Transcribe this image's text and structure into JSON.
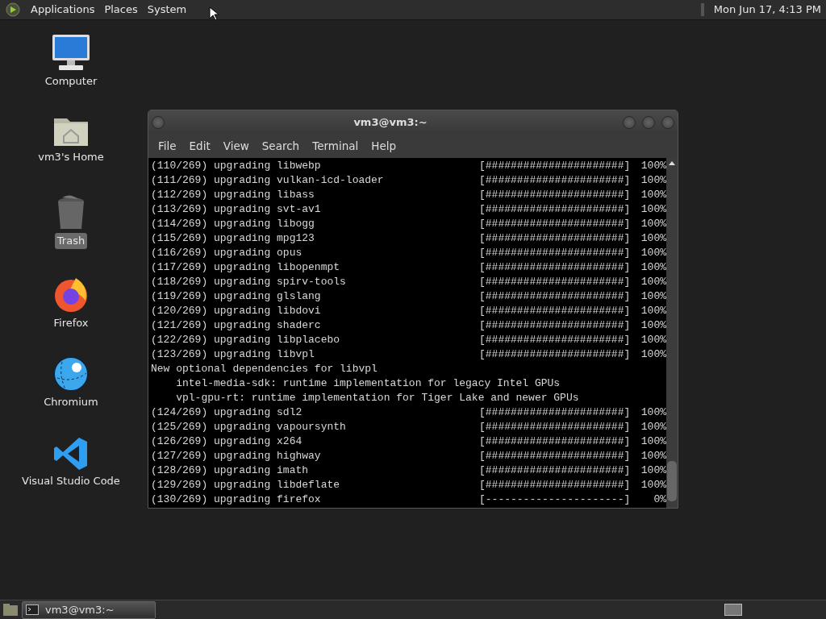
{
  "top_panel": {
    "menus": [
      "Applications",
      "Places",
      "System"
    ],
    "clock": "Mon Jun 17, 4:13 PM"
  },
  "desktop_icons": [
    {
      "kind": "computer",
      "label": "Computer",
      "selected": false
    },
    {
      "kind": "home",
      "label": "vm3's Home",
      "selected": false
    },
    {
      "kind": "trash",
      "label": "Trash",
      "selected": true
    },
    {
      "kind": "firefox",
      "label": "Firefox",
      "selected": false
    },
    {
      "kind": "chromium",
      "label": "Chromium",
      "selected": false
    },
    {
      "kind": "vscode",
      "label": "Visual Studio Code",
      "selected": false
    }
  ],
  "terminal": {
    "title": "vm3@vm3:~",
    "menus": [
      "File",
      "Edit",
      "View",
      "Search",
      "Terminal",
      "Help"
    ],
    "lines": [
      {
        "kind": "progress",
        "label": "(110/269) upgrading libwebp",
        "bar": "[######################]",
        "percent": "100%"
      },
      {
        "kind": "progress",
        "label": "(111/269) upgrading vulkan-icd-loader",
        "bar": "[######################]",
        "percent": "100%"
      },
      {
        "kind": "progress",
        "label": "(112/269) upgrading libass",
        "bar": "[######################]",
        "percent": "100%"
      },
      {
        "kind": "progress",
        "label": "(113/269) upgrading svt-av1",
        "bar": "[######################]",
        "percent": "100%"
      },
      {
        "kind": "progress",
        "label": "(114/269) upgrading libogg",
        "bar": "[######################]",
        "percent": "100%"
      },
      {
        "kind": "progress",
        "label": "(115/269) upgrading mpg123",
        "bar": "[######################]",
        "percent": "100%"
      },
      {
        "kind": "progress",
        "label": "(116/269) upgrading opus",
        "bar": "[######################]",
        "percent": "100%"
      },
      {
        "kind": "progress",
        "label": "(117/269) upgrading libopenmpt",
        "bar": "[######################]",
        "percent": "100%"
      },
      {
        "kind": "progress",
        "label": "(118/269) upgrading spirv-tools",
        "bar": "[######################]",
        "percent": "100%"
      },
      {
        "kind": "progress",
        "label": "(119/269) upgrading glslang",
        "bar": "[######################]",
        "percent": "100%"
      },
      {
        "kind": "progress",
        "label": "(120/269) upgrading libdovi",
        "bar": "[######################]",
        "percent": "100%"
      },
      {
        "kind": "progress",
        "label": "(121/269) upgrading shaderc",
        "bar": "[######################]",
        "percent": "100%"
      },
      {
        "kind": "progress",
        "label": "(122/269) upgrading libplacebo",
        "bar": "[######################]",
        "percent": "100%"
      },
      {
        "kind": "progress",
        "label": "(123/269) upgrading libvpl",
        "bar": "[######################]",
        "percent": "100%"
      },
      {
        "kind": "text",
        "text": "New optional dependencies for libvpl"
      },
      {
        "kind": "text",
        "text": "    intel-media-sdk: runtime implementation for legacy Intel GPUs"
      },
      {
        "kind": "text",
        "text": "    vpl-gpu-rt: runtime implementation for Tiger Lake and newer GPUs"
      },
      {
        "kind": "progress",
        "label": "(124/269) upgrading sdl2",
        "bar": "[######################]",
        "percent": "100%"
      },
      {
        "kind": "progress",
        "label": "(125/269) upgrading vapoursynth",
        "bar": "[######################]",
        "percent": "100%"
      },
      {
        "kind": "progress",
        "label": "(126/269) upgrading x264",
        "bar": "[######################]",
        "percent": "100%"
      },
      {
        "kind": "progress",
        "label": "(127/269) upgrading highway",
        "bar": "[######################]",
        "percent": "100%"
      },
      {
        "kind": "progress",
        "label": "(128/269) upgrading imath",
        "bar": "[######################]",
        "percent": "100%"
      },
      {
        "kind": "progress",
        "label": "(129/269) upgrading libdeflate",
        "bar": "[######################]",
        "percent": "100%"
      },
      {
        "kind": "progress",
        "label": "(130/269) upgrading firefox",
        "bar": "[----------------------]",
        "percent": "0%"
      }
    ]
  },
  "taskbar": {
    "tasks": [
      {
        "label": "vm3@vm3:~",
        "selected": true
      }
    ]
  }
}
